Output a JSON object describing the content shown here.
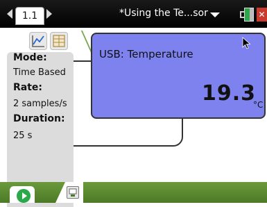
{
  "top_bar": {
    "page_tab": "1.1",
    "document_title": "*Using the Te...sor"
  },
  "info_panel": {
    "mode_label": "Mode:",
    "mode_value": "Time Based",
    "rate_label": "Rate:",
    "rate_value": "2 samples/s",
    "duration_label": "Duration:",
    "duration_value": "25 s"
  },
  "meter": {
    "sensor_name": "USB: Temperature",
    "reading": "19.3",
    "unit": "°C"
  },
  "icons": {
    "view_tabs": [
      "meter-view-icon",
      "graph-view-icon",
      "table-view-icon"
    ],
    "bottom": [
      "start-collection-icon",
      "store-dataset-icon"
    ]
  },
  "colors": {
    "meter_bg": "#7e82ee",
    "accent_green": "#6a9a3c",
    "close_red": "#c83a2e"
  }
}
